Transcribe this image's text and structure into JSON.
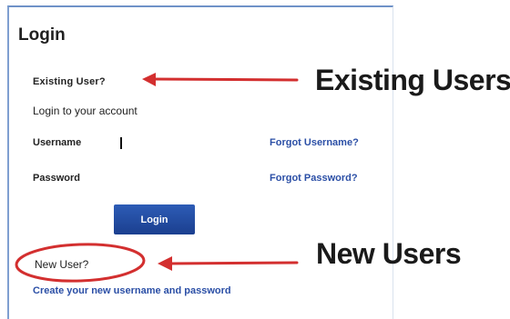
{
  "login_panel": {
    "title": "Login",
    "existing_user_heading": "Existing User?",
    "subtitle": "Login to your account",
    "username_label": "Username",
    "password_label": "Password",
    "username_value": "",
    "password_value": "",
    "forgot_username": "Forgot Username?",
    "forgot_password": "Forgot Password?",
    "login_button": "Login",
    "new_user_heading": "New User?",
    "create_account_link": "Create your new username and password"
  },
  "annotations": {
    "existing_label": "Existing Users",
    "new_label": "New Users",
    "arrow_color": "#d32f2f",
    "circle_color": "#d32f2f"
  },
  "colors": {
    "link": "#2b4fa6",
    "button": "#1f4599",
    "panel_border": "#6f92c8"
  }
}
